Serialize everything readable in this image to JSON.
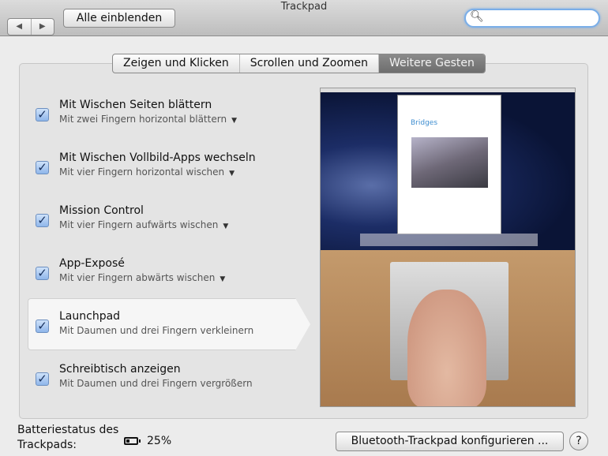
{
  "window": {
    "title": "Trackpad"
  },
  "toolbar": {
    "back": "◀",
    "forward": "▶",
    "show_all": "Alle einblenden",
    "search_placeholder": ""
  },
  "tabs": [
    {
      "label": "Zeigen und Klicken"
    },
    {
      "label": "Scrollen und Zoomen"
    },
    {
      "label": "Weitere Gesten",
      "active": true
    }
  ],
  "gestures": [
    {
      "title": "Mit Wischen Seiten blättern",
      "subtitle": "Mit zwei Fingern horizontal blättern",
      "checked": true,
      "dropdown": true
    },
    {
      "title": "Mit Wischen Vollbild-Apps wechseln",
      "subtitle": "Mit vier Fingern horizontal wischen",
      "checked": true,
      "dropdown": true
    },
    {
      "title": "Mission Control",
      "subtitle": "Mit vier Fingern aufwärts wischen",
      "checked": true,
      "dropdown": true
    },
    {
      "title": "App-Exposé",
      "subtitle": "Mit vier Fingern abwärts wischen",
      "checked": true,
      "dropdown": true
    },
    {
      "title": "Launchpad",
      "subtitle": "Mit Daumen und drei Fingern verkleinern",
      "checked": true,
      "selected": true
    },
    {
      "title": "Schreibtisch anzeigen",
      "subtitle": "Mit Daumen und drei Fingern vergrößern",
      "checked": true
    }
  ],
  "preview": {
    "doc_title": "Bridges"
  },
  "footer": {
    "battery_label_1": "Batteriestatus des",
    "battery_label_2": "Trackpads:",
    "battery_value": "25%",
    "battery_percent": 25,
    "configure": "Bluetooth-Trackpad konfigurieren ...",
    "help": "?"
  }
}
